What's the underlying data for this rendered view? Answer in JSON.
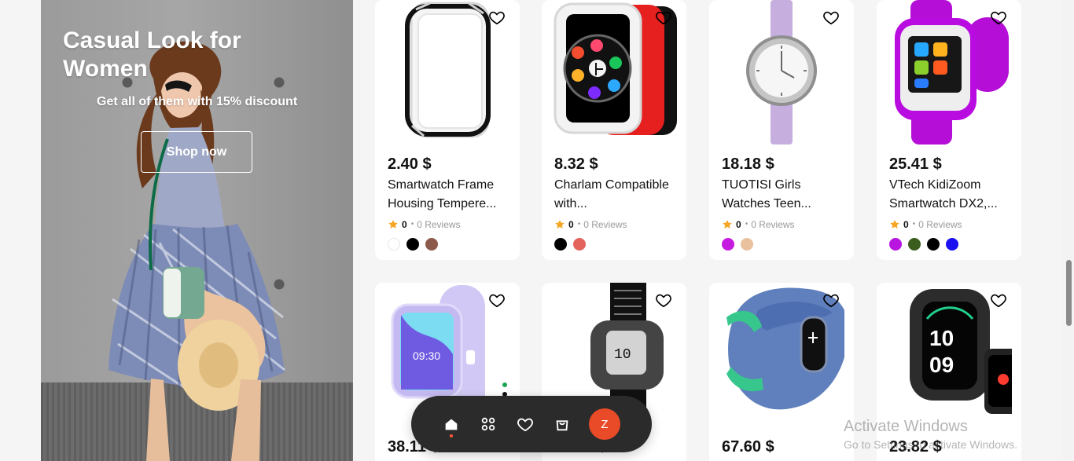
{
  "promo": {
    "title": "Casual Look for Women",
    "subtitle": "Get all of them with 15% discount",
    "button_label": "Shop now"
  },
  "products": [
    {
      "price": "2.40 $",
      "title": "Smartwatch Frame Housing Tempere...",
      "rating": "0",
      "reviews": "0 Reviews",
      "colors": [
        "#ffffff",
        "#000000",
        "#8b5a4a"
      ]
    },
    {
      "price": "8.32 $",
      "title": "Charlam Compatible with...",
      "rating": "0",
      "reviews": "0 Reviews",
      "colors": [
        "#000000",
        "#e3645c"
      ]
    },
    {
      "price": "18.18 $",
      "title": "TUOTISI Girls Watches Teen...",
      "rating": "0",
      "reviews": "0 Reviews",
      "colors": [
        "#c51be0",
        "#e9c19e"
      ]
    },
    {
      "price": "25.41 $",
      "title": "VTech KidiZoom Smartwatch DX2,...",
      "rating": "0",
      "reviews": "0 Reviews",
      "colors": [
        "#b815e0",
        "#3b5d1d",
        "#000000",
        "#1a10f0"
      ]
    },
    {
      "price": "38.11 $",
      "title": ""
    },
    {
      "price": "24.20 $",
      "title": ""
    },
    {
      "price": "67.60 $",
      "title": ""
    },
    {
      "price": "23.82 $",
      "title": ""
    }
  ],
  "nav": {
    "items": [
      "home-icon",
      "categories-icon",
      "favorites-icon",
      "bag-icon"
    ],
    "avatar_initial": "Z"
  },
  "watermark": {
    "title": "Activate Windows",
    "subtitle": "Go to Settings to activate Windows."
  },
  "colors": {
    "accent": "#e94b28",
    "nav_background": "#2b2b2b",
    "page_background": "#f5f5f5",
    "rating_star": "#f6a623"
  }
}
